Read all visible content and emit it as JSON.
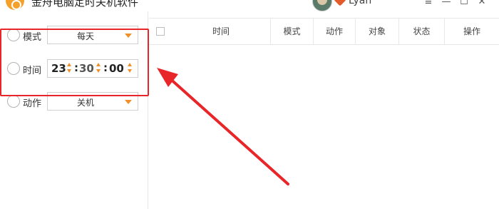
{
  "app": {
    "title": "金舟电脑定时关机软件"
  },
  "user": {
    "name": "Lyan"
  },
  "window_controls": {
    "menu": "≡",
    "minimize": "—",
    "maximize": "☐",
    "close": "✕"
  },
  "settings": {
    "mode": {
      "label": "模式",
      "value": "每天",
      "icon": "clock-icon"
    },
    "time": {
      "label": "时间",
      "hour": "23",
      "minute": "30",
      "second": "00",
      "icon": "time-icon"
    },
    "action": {
      "label": "动作",
      "value": "关机",
      "icon": "action-icon"
    }
  },
  "table": {
    "columns": [
      "时间",
      "模式",
      "动作",
      "对象",
      "状态",
      "操作"
    ],
    "rows": []
  },
  "colors": {
    "accent": "#f0902a",
    "highlight": "#e8262a"
  }
}
